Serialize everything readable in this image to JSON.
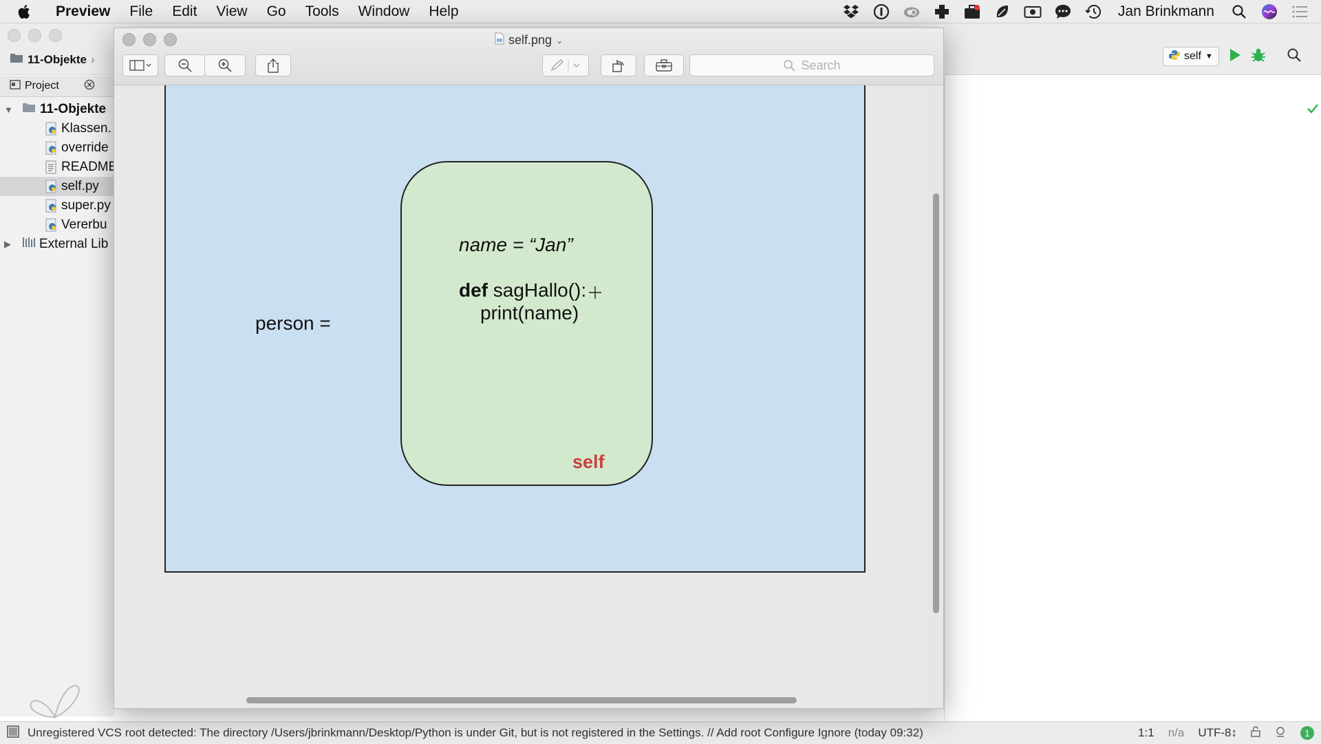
{
  "menubar": {
    "app_name": "Preview",
    "items": [
      "File",
      "Edit",
      "View",
      "Go",
      "Tools",
      "Window",
      "Help"
    ],
    "user_name": "Jan Brinkmann",
    "tray_icons": [
      "dropbox-icon",
      "1password-icon",
      "cloud-icon",
      "plus-app-icon",
      "briefcase-icon",
      "leaf-icon",
      "camera-icon",
      "chat-bubble-icon",
      "time-machine-icon"
    ]
  },
  "ide": {
    "breadcrumb": "11-Objekte",
    "project_tab": "Project",
    "tree": {
      "root": "11-Objekte",
      "files": [
        "Klassen.",
        "override",
        "README",
        "self.py",
        "super.py",
        "Vererbu"
      ],
      "selected": "self.py",
      "external": "External Lib"
    },
    "run_config": "self"
  },
  "preview": {
    "title": "self.png",
    "search_placeholder": "Search",
    "slide": {
      "variable_label": "person =",
      "code_line1": "name = “Jan”",
      "code_keyword": "def",
      "code_line2_rest": " sagHallo():",
      "code_line3": "print(name)",
      "self_tag": "self"
    }
  },
  "statusbar": {
    "message": "Unregistered VCS root detected: The directory /Users/jbrinkmann/Desktop/Python is under Git, but is not registered in the Settings. // Add root  Configure  Ignore (today 09:32)",
    "position": "1:1",
    "na": "n/a",
    "encoding": "UTF-8↕",
    "notification_count": "1"
  },
  "colors": {
    "slide_background": "#cadff2",
    "box_background": "#d3e9cd",
    "self_tag": "#c94040",
    "run_green": "#2bb24c"
  }
}
